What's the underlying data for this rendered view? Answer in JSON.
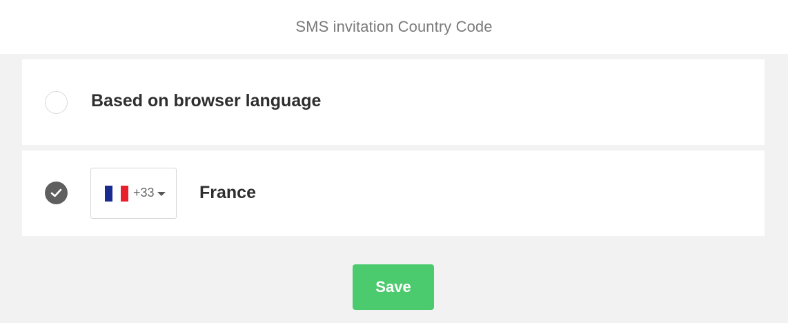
{
  "header": {
    "title": "SMS invitation Country Code"
  },
  "options": [
    {
      "label": "Based on browser language",
      "selected": false
    },
    {
      "label": "France",
      "selected": true,
      "country_select": {
        "flag_icon": "france-flag-icon",
        "dial_code": "+33"
      }
    }
  ],
  "actions": {
    "save_label": "Save"
  },
  "colors": {
    "background": "#f2f2f2",
    "save_button": "#4ccb6e",
    "radio_checked": "#5f5f5f"
  }
}
